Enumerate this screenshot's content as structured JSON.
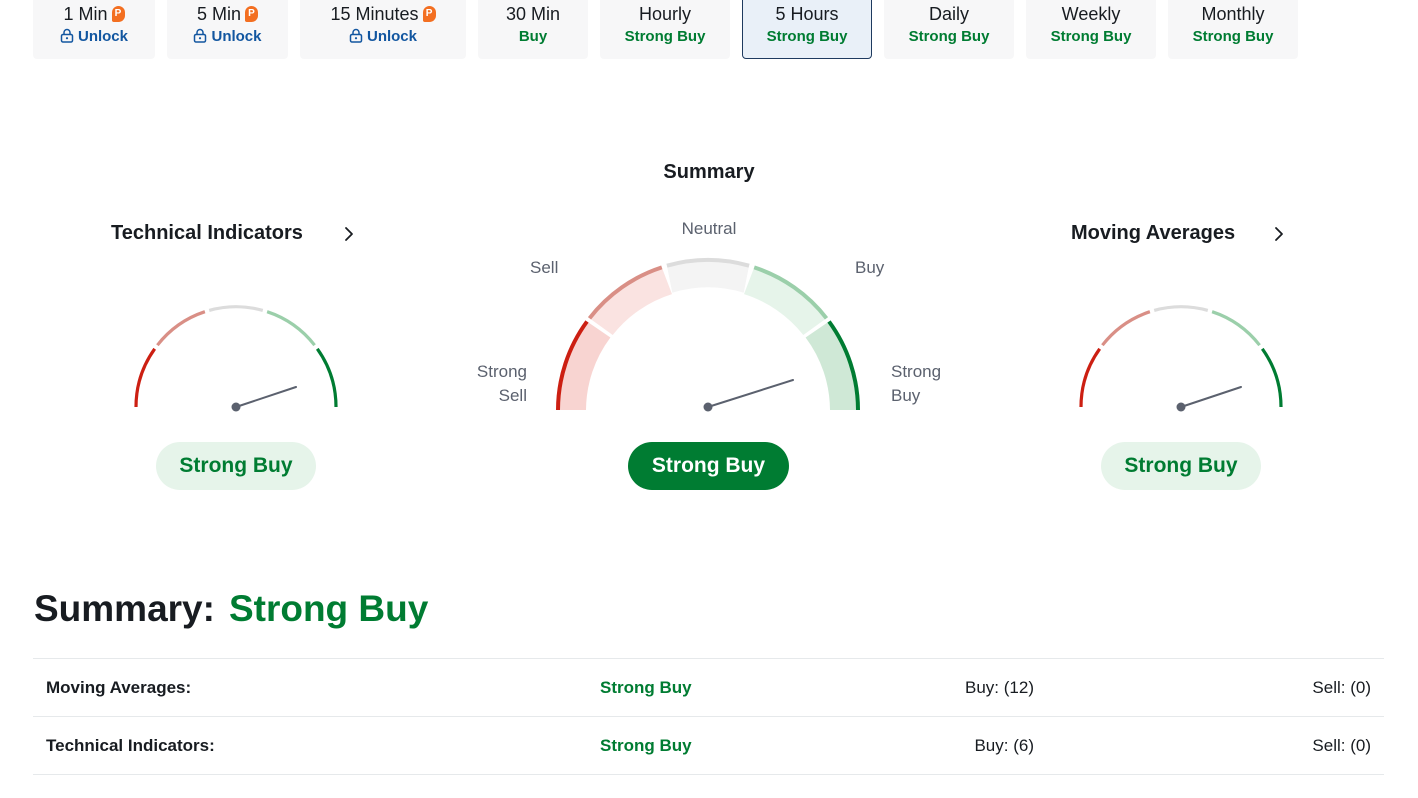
{
  "timeframes": [
    {
      "label": "1 Min",
      "status": "Unlock",
      "locked": true,
      "pro_badge": "P"
    },
    {
      "label": "5 Min",
      "status": "Unlock",
      "locked": true,
      "pro_badge": "P"
    },
    {
      "label": "15 Minutes",
      "status": "Unlock",
      "locked": true,
      "pro_badge": "P"
    },
    {
      "label": "30 Min",
      "status": "Buy",
      "locked": false
    },
    {
      "label": "Hourly",
      "status": "Strong Buy",
      "locked": false
    },
    {
      "label": "5 Hours",
      "status": "Strong Buy",
      "locked": false,
      "active": true
    },
    {
      "label": "Daily",
      "status": "Strong Buy",
      "locked": false
    },
    {
      "label": "Weekly",
      "status": "Strong Buy",
      "locked": false
    },
    {
      "label": "Monthly",
      "status": "Strong Buy",
      "locked": false
    }
  ],
  "gauges": {
    "technical": {
      "title": "Technical Indicators",
      "verdict": "Strong Buy"
    },
    "summary": {
      "title": "Summary",
      "verdict": "Strong Buy",
      "labels": {
        "strong_sell": "Strong Sell",
        "sell": "Sell",
        "neutral": "Neutral",
        "buy": "Buy",
        "strong_buy": "Strong Buy"
      }
    },
    "moving_averages": {
      "title": "Moving Averages",
      "verdict": "Strong Buy"
    }
  },
  "summary": {
    "heading_label": "Summary:",
    "heading_value": "Strong Buy",
    "rows": [
      {
        "name": "Moving Averages:",
        "verdict": "Strong Buy",
        "buy": "Buy: (12)",
        "sell": "Sell: (0)"
      },
      {
        "name": "Technical Indicators:",
        "verdict": "Strong Buy",
        "buy": "Buy: (6)",
        "sell": "Sell: (0)"
      }
    ]
  },
  "colors": {
    "strong_sell": "#cc1f12",
    "sell": "#d98f86",
    "neutral": "#dcdcdc",
    "buy": "#9bcfaa",
    "strong_buy": "#007c32",
    "link": "#1256a0",
    "pro": "#f36f21"
  },
  "icons": {
    "lock": "lock-icon",
    "pro": "pro-badge-icon",
    "chevron": "chevron-right-icon"
  }
}
